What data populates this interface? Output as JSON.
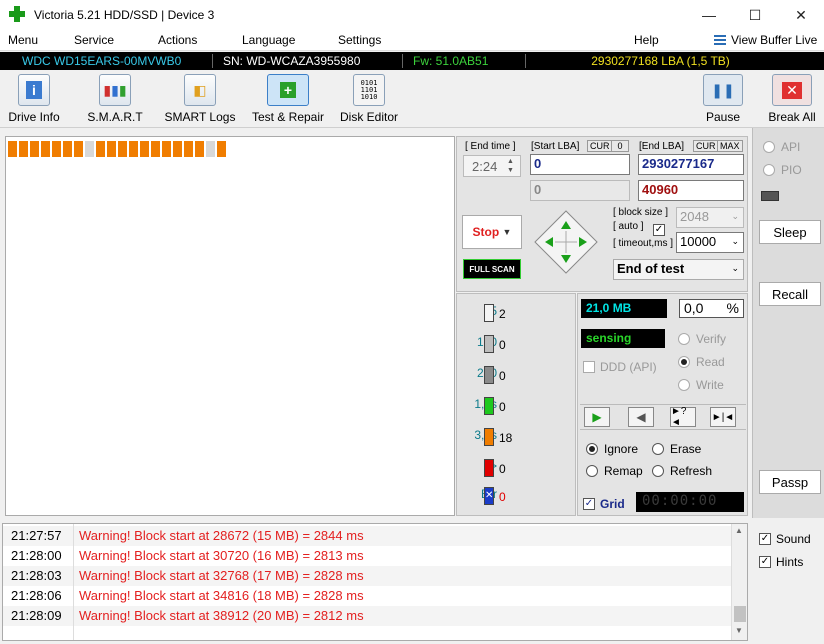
{
  "window": {
    "title": "Victoria 5.21 HDD/SSD | Device 3"
  },
  "menu": [
    "Menu",
    "Service",
    "Actions",
    "Language",
    "Settings",
    "Help"
  ],
  "view_buffer": "View Buffer Live",
  "drive": {
    "model": "WDC WD15EARS-00MVWB0",
    "sn": "SN: WD-WCAZA3955980",
    "fw": "Fw: 51.0AB51",
    "lba": "2930277168 LBA (1,5 TB)"
  },
  "toolbar": {
    "drive_info": "Drive Info",
    "smart": "S.M.A.R.T",
    "smart_logs": "SMART Logs",
    "test_repair": "Test & Repair",
    "disk_editor": "Disk Editor",
    "pause": "Pause",
    "break_all": "Break All"
  },
  "controls": {
    "end_time_label": "[ End time ]",
    "end_time": "2:24",
    "start_lba_label": "[Start LBA]",
    "start_lba": "0",
    "start_lba_cur": "CUR",
    "start_lba_zero": "0",
    "start_lba2": "0",
    "end_lba_label": "[End LBA]",
    "end_lba_cur": "CUR",
    "end_lba_max": "MAX",
    "end_lba": "2930277167",
    "end_lba2": "40960",
    "block_size_label": "[ block size ]",
    "auto_label": "[ auto ]",
    "block_size": "2048",
    "timeout_label": "[ timeout,ms ]",
    "timeout": "10000",
    "stop": "Stop",
    "full_scan": "FULL SCAN",
    "end_of_test": "End of test"
  },
  "side": {
    "api": "API",
    "pio": "PIO",
    "sleep": "Sleep",
    "recall": "Recall",
    "passp": "Passp"
  },
  "stats": [
    {
      "label": "25",
      "count": "2",
      "color": "#f4f4f4"
    },
    {
      "label": "100",
      "count": "0",
      "color": "#bdbdbd"
    },
    {
      "label": "250",
      "count": "0",
      "color": "#8a8a8a"
    },
    {
      "label": "1,0s",
      "count": "0",
      "color": "#1ec81e"
    },
    {
      "label": "3,0s",
      "count": "18",
      "color": "#f07d00"
    },
    {
      "label": ">",
      "count": "0",
      "color": "#e00000"
    },
    {
      "label": "Err",
      "count": "0",
      "color": "#1a3cc8"
    }
  ],
  "progress": {
    "mb": "21,0 MB",
    "pct": "0,0",
    "pct_sign": "%",
    "status": "sensing"
  },
  "modes": {
    "ddd": "DDD (API)",
    "verify": "Verify",
    "read": "Read",
    "write": "Write"
  },
  "actions": {
    "ignore": "Ignore",
    "erase": "Erase",
    "remap": "Remap",
    "refresh": "Refresh",
    "grid": "Grid",
    "timer": "00:00:00"
  },
  "log": [
    {
      "time": "21:27:57",
      "msg": "Warning! Block start at 28672 (15 MB)  = 2844 ms"
    },
    {
      "time": "21:28:00",
      "msg": "Warning! Block start at 30720 (16 MB)  = 2813 ms"
    },
    {
      "time": "21:28:03",
      "msg": "Warning! Block start at 32768 (17 MB)  = 2828 ms"
    },
    {
      "time": "21:28:06",
      "msg": "Warning! Block start at 34816 (18 MB)  = 2828 ms"
    },
    {
      "time": "21:28:09",
      "msg": "Warning! Block start at 38912 (20 MB)  = 2812 ms"
    }
  ],
  "options": {
    "sound": "Sound",
    "hints": "Hints"
  }
}
